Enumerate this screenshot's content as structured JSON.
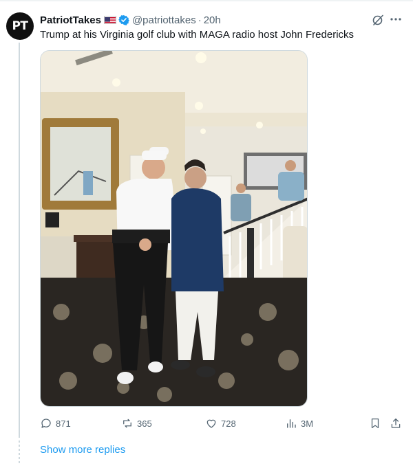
{
  "author": {
    "avatar_initials": "PT",
    "display_name": "PatriotTakes",
    "handle": "@patriottakes",
    "separator": "·",
    "timestamp": "20h",
    "badges": [
      "us-flag-icon",
      "verified-badge-icon"
    ]
  },
  "tweet": {
    "text": "Trump at his Virginia golf club with MAGA radio host John Fredericks"
  },
  "media": {
    "type": "photo"
  },
  "actions": {
    "replies": "871",
    "reposts": "365",
    "likes": "728",
    "views": "3M"
  },
  "thread": {
    "show_more": "Show more replies"
  },
  "colors": {
    "text_primary": "#0f1419",
    "text_secondary": "#536471",
    "link": "#1d9bf0",
    "verified": "#1d9bf0",
    "border": "#cfd9de"
  }
}
